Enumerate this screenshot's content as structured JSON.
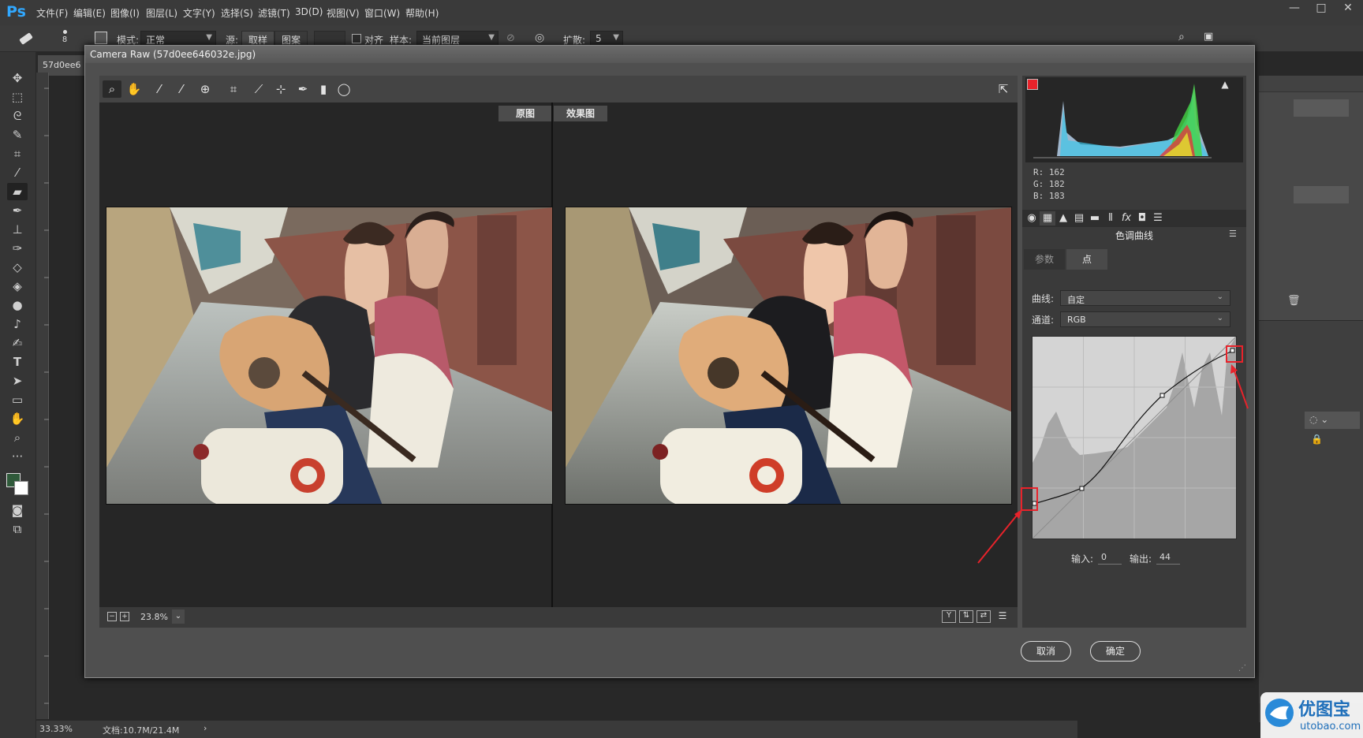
{
  "app": {
    "logo": "Ps",
    "menu": [
      "文件(F)",
      "编辑(E)",
      "图像(I)",
      "图层(L)",
      "文字(Y)",
      "选择(S)",
      "滤镜(T)",
      "3D(D)",
      "视图(V)",
      "窗口(W)",
      "帮助(H)"
    ],
    "window_controls": [
      "—",
      "□",
      "✕"
    ]
  },
  "options_bar": {
    "brush_size": "8",
    "mode_label": "模式:",
    "mode_value": "正常",
    "source_label": "源:",
    "source_sample": "取样",
    "source_pattern": "图案",
    "align_label": "对齐",
    "sample_label": "样本:",
    "sample_value": "当前图层",
    "spread_label": "扩散:",
    "spread_value": "5"
  },
  "document": {
    "tab_label": "57d0ee6",
    "zoom": "33.33%",
    "doc_info": "文档:10.7M/21.4M",
    "ruler_marks": [
      "28",
      "29",
      "30"
    ]
  },
  "camera_raw": {
    "title": "Camera Raw (57d0ee646032e.jpg)",
    "before_label": "原图",
    "after_label": "效果图",
    "zoom_value": "23.8%",
    "rgb": {
      "r_label": "R:",
      "r": "162",
      "g_label": "G:",
      "g": "182",
      "b_label": "B:",
      "b": "183"
    },
    "panel_title": "色调曲线",
    "tabs": [
      "参数",
      "点"
    ],
    "curve_label": "曲线:",
    "curve_value": "自定",
    "channel_label": "通道:",
    "channel_value": "RGB",
    "input_label": "输入:",
    "input_value": "0",
    "output_label": "输出:",
    "output_value": "44",
    "cancel": "取消",
    "ok": "确定"
  },
  "watermark": {
    "name": "优图宝",
    "url": "utobao.com"
  },
  "colors": {
    "accent_red": "#e8232b",
    "ps_blue": "#31a8ff",
    "foreground": "#2f5a3a",
    "background": "#ffffff"
  }
}
